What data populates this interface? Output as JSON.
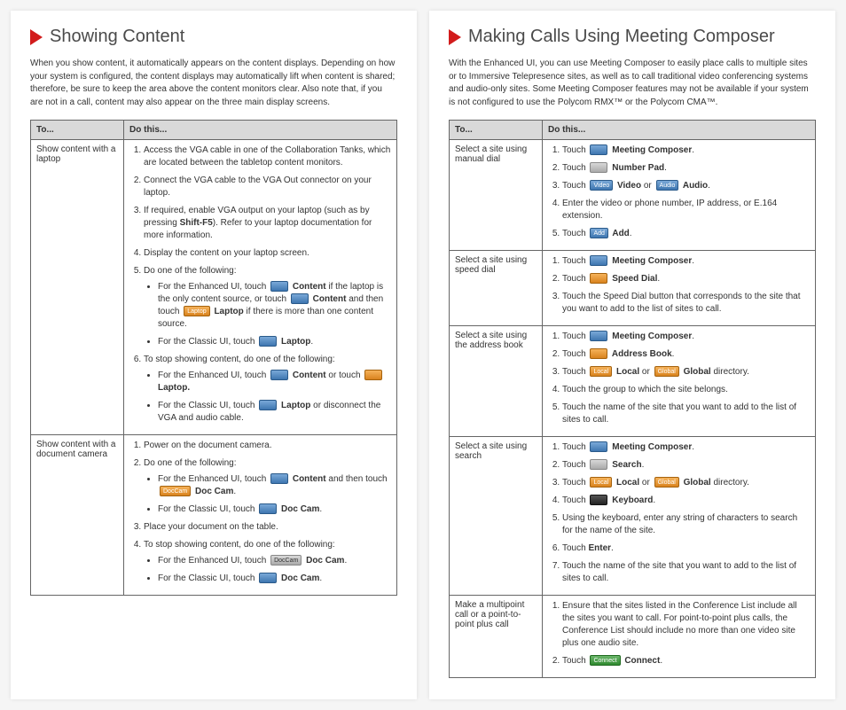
{
  "left": {
    "title": "Showing Content",
    "intro": "When you show content, it automatically appears on the content displays. Depending on how your system is configured, the content displays may automatically lift when content is shared; therefore, be sure to keep the area above the content monitors clear. Also note that, if you are not in a call, content may also appear on the three main display screens.",
    "header_to": "To...",
    "header_do": "Do this...",
    "row1_to": "Show content with a laptop",
    "row1": {
      "s1": "Access the VGA cable in one of the Collaboration Tanks, which are located between the tabletop content monitors.",
      "s2": "Connect the VGA cable to the VGA Out connector on your laptop.",
      "s3a": "If required, enable VGA output on your laptop (such as by pressing ",
      "s3b": "Shift-F5",
      "s3c": "). Refer to your laptop documentation for more information.",
      "s4": "Display the content on your laptop screen.",
      "s5": "Do one of the following:",
      "s5a1": "For the Enhanced UI, touch ",
      "s5a2": " Content",
      "s5a3": " if the laptop is the only content source, or touch ",
      "s5a4": " Content",
      "s5a5": " and then touch ",
      "s5a6": " Laptop",
      "s5a7": " if there is more than one content source.",
      "s5b1": "For the Classic UI, touch ",
      "s5b2": " Laptop",
      "s5b3": ".",
      "s6": "To stop showing content, do one of the following:",
      "s6a1": "For the Enhanced UI, touch ",
      "s6a2": " Content",
      "s6a3": " or touch ",
      "s6a4": " Laptop.",
      "s6b1": "For the Classic UI, touch ",
      "s6b2": " Laptop",
      "s6b3": " or disconnect the VGA and audio cable."
    },
    "row2_to": "Show content with a document camera",
    "row2": {
      "s1": "Power on the document camera.",
      "s2": "Do one of the following:",
      "s2a1": "For the Enhanced UI, touch ",
      "s2a2": " Content",
      "s2a3": " and then touch ",
      "s2a4": " Doc Cam",
      "s2a5": ".",
      "s2b1": "For the Classic UI, touch ",
      "s2b2": " Doc Cam",
      "s2b3": ".",
      "s3": "Place your document on the table.",
      "s4": "To stop showing content, do one of the following:",
      "s4a1": "For the Enhanced UI, touch ",
      "s4a2": " Doc Cam",
      "s4a3": ".",
      "s4b1": "For the Classic UI, touch ",
      "s4b2": " Doc Cam",
      "s4b3": "."
    }
  },
  "right": {
    "title": "Making Calls Using Meeting Composer",
    "intro": "With the Enhanced UI, you can use Meeting Composer to easily place calls to multiple sites or to Immersive Telepresence sites, as well as to call traditional video conferencing systems and audio-only sites. Some Meeting Composer features may not be available if your system is not configured to use the Polycom RMX™ or the Polycom CMA™.",
    "header_to": "To...",
    "header_do": "Do this...",
    "r1_to": "Select a site using manual dial",
    "r1": {
      "s1a": "Touch ",
      "s1b": " Meeting Composer",
      "s1c": ".",
      "s2a": "Touch ",
      "s2b": " Number Pad",
      "s2c": ".",
      "s3a": "Touch ",
      "s3b": " Video",
      "s3c": " or ",
      "s3d": " Audio",
      "s3e": ".",
      "s4": "Enter the video or phone number, IP address, or E.164 extension.",
      "s5a": "Touch ",
      "s5b": " Add",
      "s5c": "."
    },
    "r2_to": "Select a site using speed dial",
    "r2": {
      "s1a": "Touch ",
      "s1b": " Meeting Composer",
      "s1c": ".",
      "s2a": "Touch ",
      "s2b": " Speed Dial",
      "s2c": ".",
      "s3": "Touch the Speed Dial button that corresponds to the site that you want to add to the list of sites to call."
    },
    "r3_to": "Select a site using the address book",
    "r3": {
      "s1a": "Touch ",
      "s1b": " Meeting Composer",
      "s1c": ".",
      "s2a": "Touch ",
      "s2b": " Address Book",
      "s2c": ".",
      "s3a": "Touch ",
      "s3b": " Local",
      "s3c": " or ",
      "s3d": " Global",
      "s3e": " directory.",
      "s4": "Touch the group to which the site belongs.",
      "s5": "Touch the name of the site that you want to add to the list of sites to call."
    },
    "r4_to": "Select a site using search",
    "r4": {
      "s1a": "Touch ",
      "s1b": " Meeting Composer",
      "s1c": ".",
      "s2a": "Touch ",
      "s2b": " Search",
      "s2c": ".",
      "s3a": "Touch ",
      "s3b": " Local",
      "s3c": " or ",
      "s3d": " Global",
      "s3e": " directory.",
      "s4a": "Touch ",
      "s4b": " Keyboard",
      "s4c": ".",
      "s5": "Using the keyboard, enter any string of characters to search for the name of the site.",
      "s6a": "Touch ",
      "s6b": "Enter",
      "s6c": ".",
      "s7": "Touch the name of the site that you want to add to the list of sites to call."
    },
    "r5_to": "Make a multipoint call or a point-to-point plus call",
    "r5": {
      "s1": "Ensure that the sites listed in the Conference List include all the sites you want to call. For point-to-point plus calls, the Conference List should include no more than one video site plus one audio site.",
      "s2a": "Touch ",
      "s2b": " Connect",
      "s2c": "."
    }
  },
  "btn_labels": {
    "video": "Video",
    "audio": "Audio",
    "add": "Add",
    "local": "Local",
    "global": "Global",
    "connect": "Connect",
    "laptop": "Laptop",
    "doccam": "DocCam"
  }
}
